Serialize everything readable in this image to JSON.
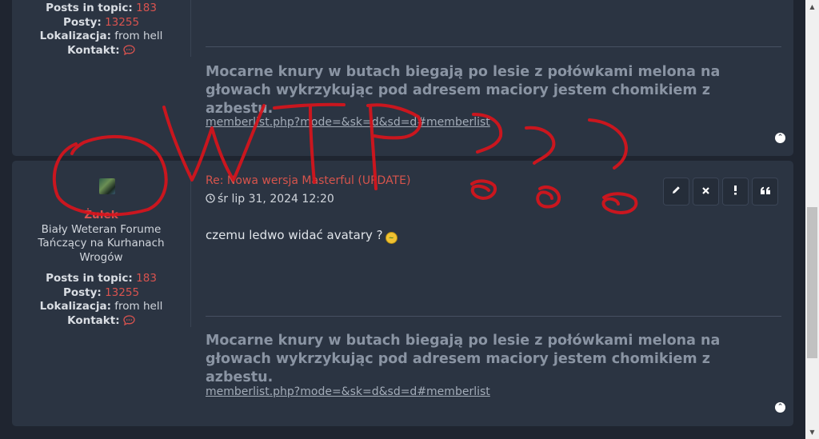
{
  "post1": {
    "stats": [
      {
        "label": "Posts in topic:",
        "value": "183"
      },
      {
        "label": "Posty:",
        "value": "13255"
      },
      {
        "label": "Lokalizacja:",
        "plain": "from hell"
      },
      {
        "label": "Kontakt:",
        "icon": "speech-bubble-icon"
      }
    ],
    "signature": "Mocarne knury w butach biegają po lesie z połówkami melona na głowach wykrzykując pod adresem maciory jestem chomikiem z azbestu.",
    "signature_link": "memberlist.php?mode=&sk=d&sd=d#memberlist"
  },
  "post2": {
    "username": "Żułek",
    "rank": "Biały Weteran Forume Tańczący na Kurhanach Wrogów",
    "title": "Re: Nowa wersja Masterful (UPDATE)",
    "date": "śr lip 31, 2024 12:20",
    "content": "czemu ledwo widać avatary ?",
    "stats": [
      {
        "label": "Posts in topic:",
        "value": "183"
      },
      {
        "label": "Posty:",
        "value": "13255"
      },
      {
        "label": "Lokalizacja:",
        "plain": "from hell"
      },
      {
        "label": "Kontakt:",
        "icon": "speech-bubble-icon"
      }
    ],
    "actions": [
      "edit-icon",
      "delete-icon",
      "report-icon",
      "quote-icon"
    ],
    "signature": "Mocarne knury w butach biegają po lesie z połówkami melona na głowach wykrzykując pod adresem maciory jestem chomikiem z azbestu.",
    "signature_link": "memberlist.php?mode=&sk=d&sd=d#memberlist"
  },
  "annotation": {
    "text": "WTF???",
    "color": "#d8141c"
  }
}
